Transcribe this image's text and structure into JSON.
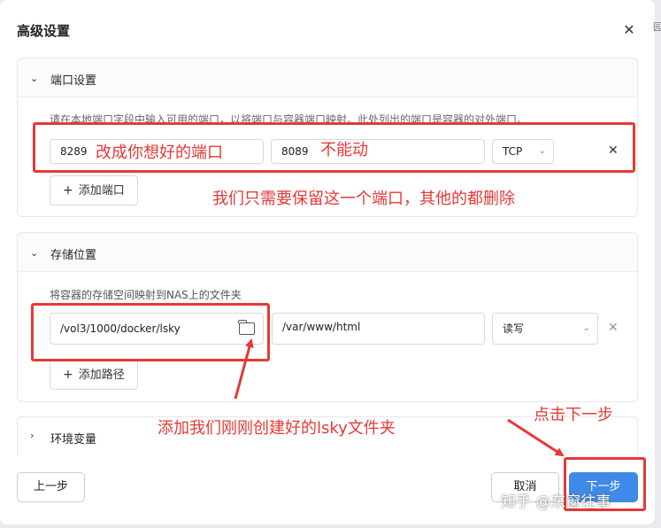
{
  "dialog": {
    "title": "高级设置",
    "edge_glyph": "园"
  },
  "ports": {
    "title": "端口设置",
    "hint": "请在本地端口字段中输入可用的端口，以将端口与容器端口映射。此处列出的端口是容器的对外端口。",
    "local_port": "8289",
    "container_port": "8089",
    "protocol": "TCP",
    "add_label": "添加端口"
  },
  "storage": {
    "title": "存储位置",
    "hint": "将容器的存储空间映射到NAS上的文件夹",
    "local_path": "/vol3/1000/docker/lsky",
    "container_path": "/var/www/html",
    "permission": "读写",
    "add_label": "添加路径"
  },
  "env": {
    "title": "环境变量"
  },
  "footer": {
    "prev": "上一步",
    "cancel": "取消",
    "next": "下一步"
  },
  "annotations": {
    "a1": "改成你想好的端口",
    "a2": "不能动",
    "a3": "我们只需要保留这一个端口，其他的都删除",
    "a4": "添加我们刚刚创建好的lsky文件夹",
    "a5": "点击下一步"
  },
  "watermark": "知乎 @东窗往事",
  "colors": {
    "accent": "#3f8ae6",
    "annotation": "#e53935"
  }
}
